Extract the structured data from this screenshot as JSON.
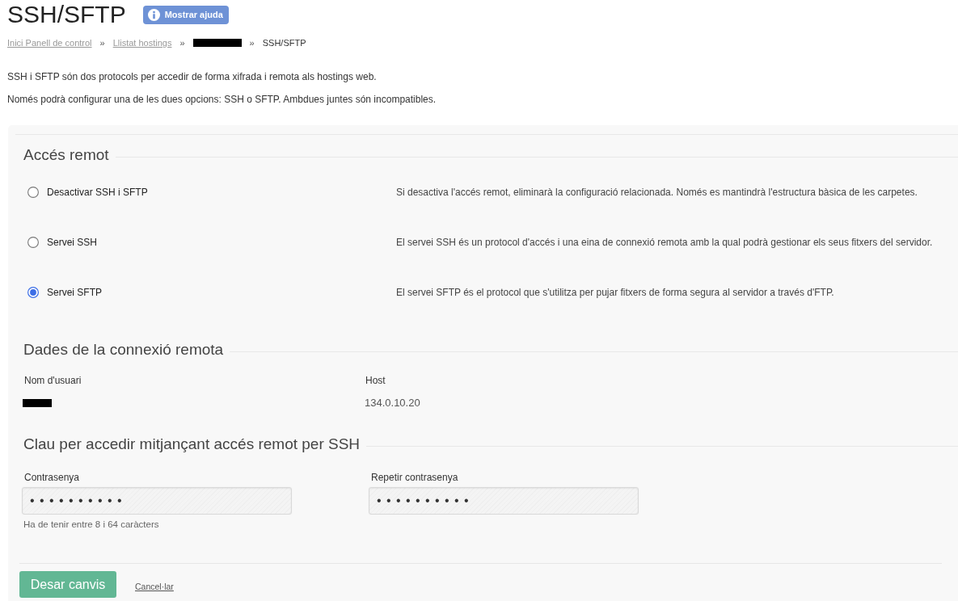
{
  "page": {
    "title": "SSH/SFTP",
    "help_button": "Mostrar ajuda"
  },
  "breadcrumb": [
    {
      "kind": "link",
      "label": "Inici Panell de control"
    },
    {
      "kind": "separator",
      "label": "»"
    },
    {
      "kind": "link",
      "label": "Llistat hostings"
    },
    {
      "kind": "separator",
      "label": "»"
    },
    {
      "kind": "redacted"
    },
    {
      "kind": "separator",
      "label": "»"
    },
    {
      "kind": "current",
      "label": "SSH/SFTP"
    }
  ],
  "intro": [
    "SSH i SFTP són dos protocols per accedir de forma xifrada i remota als hostings web.",
    "Només podrà configurar una de les dues opcions: SSH o SFTP. Ambdues juntes són incompatibles."
  ],
  "remote_access": {
    "title": "Accés remot",
    "options": [
      {
        "label": "Desactivar SSH i SFTP",
        "description": "Si desactiva l'accés remot, eliminarà la configuració relacionada. Només es mantindrà l'estructura bàsica de les carpetes.",
        "selected": false
      },
      {
        "label": "Servei SSH",
        "description": "El servei SSH és un protocol d'accés i una eina de connexió remota amb la qual podrà gestionar els seus fitxers del servidor.",
        "selected": false
      },
      {
        "label": "Servei SFTP",
        "description": "El servei SFTP és el protocol que s'utilitza per pujar fitxers de forma segura al servidor a través d'FTP.",
        "selected": true
      }
    ]
  },
  "connection": {
    "title": "Dades de la connexió remota",
    "fields": [
      {
        "label": "Nom d'usuari",
        "kind": "redacted"
      },
      {
        "label": "Host",
        "kind": "text",
        "value": "134.0.10.20"
      }
    ]
  },
  "password": {
    "title": "Clau per accedir mitjançant accés remot per SSH",
    "fields": [
      {
        "label": "Contrasenya",
        "value": "••••••••••",
        "hint": "Ha de tenir entre 8 i 64 caràcters"
      },
      {
        "label": "Repetir contrasenya",
        "value": "••••••••••"
      }
    ]
  },
  "actions": {
    "save": "Desar canvis",
    "cancel": "Cancel·lar"
  }
}
